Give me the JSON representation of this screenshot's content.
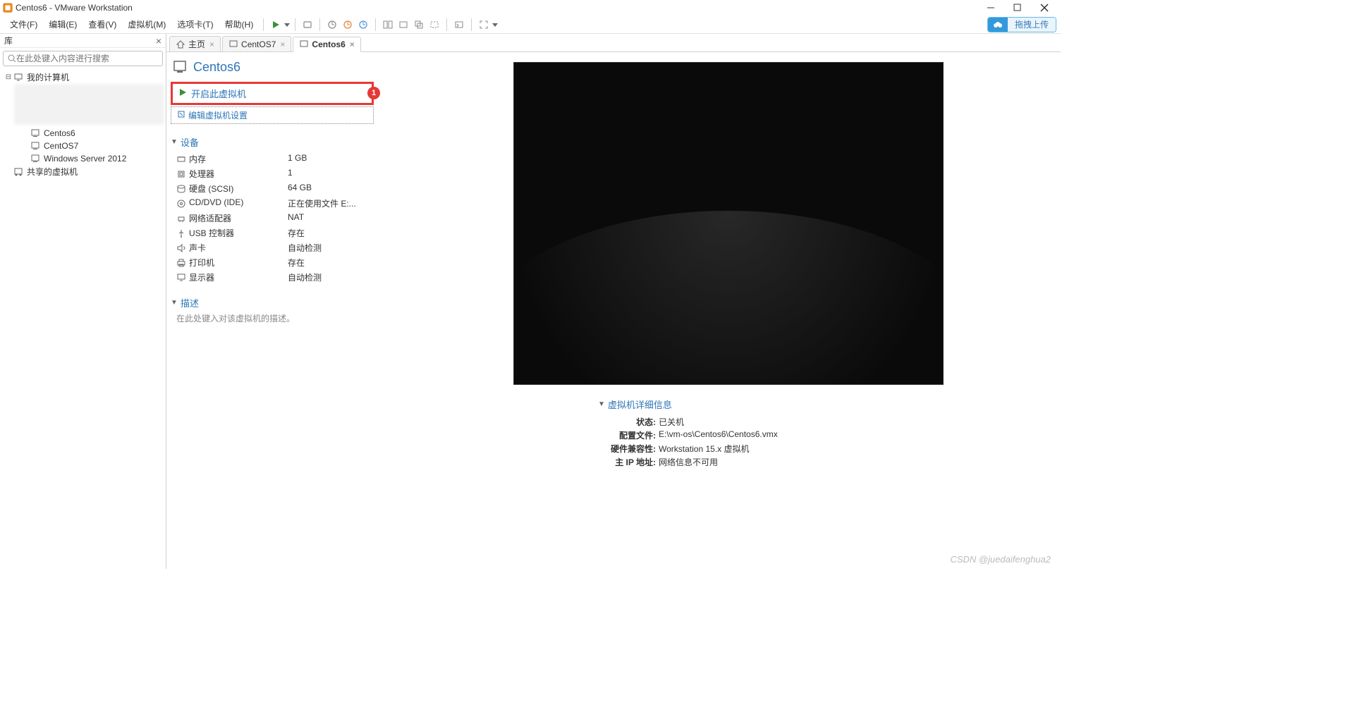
{
  "window": {
    "title": "Centos6 - VMware Workstation"
  },
  "menu": {
    "file": "文件(F)",
    "edit": "编辑(E)",
    "view": "查看(V)",
    "vm": "虚拟机(M)",
    "tabs": "选项卡(T)",
    "help": "帮助(H)"
  },
  "upload_badge": "拖拽上传",
  "sidebar": {
    "title": "库",
    "search_placeholder": "在此处键入内容进行搜索",
    "root": "我的计算机",
    "items": [
      "Centos6",
      "CentOS7",
      "Windows Server 2012"
    ],
    "shared": "共享的虚拟机"
  },
  "tabs": [
    {
      "label": "主页",
      "icon": "home",
      "active": false
    },
    {
      "label": "CentOS7",
      "icon": "vm",
      "active": false
    },
    {
      "label": "Centos6",
      "icon": "vm",
      "active": true
    }
  ],
  "vm": {
    "name": "Centos6",
    "power_on": "开启此虚拟机",
    "edit_settings": "编辑虚拟机设置",
    "badge": "1",
    "devices_header": "设备",
    "devices": [
      {
        "icon": "memory",
        "label": "内存",
        "value": "1 GB"
      },
      {
        "icon": "cpu",
        "label": "处理器",
        "value": "1"
      },
      {
        "icon": "disk",
        "label": "硬盘 (SCSI)",
        "value": "64 GB"
      },
      {
        "icon": "cd",
        "label": "CD/DVD (IDE)",
        "value": "正在使用文件 E:..."
      },
      {
        "icon": "network",
        "label": "网络适配器",
        "value": "NAT"
      },
      {
        "icon": "usb",
        "label": "USB 控制器",
        "value": "存在"
      },
      {
        "icon": "sound",
        "label": "声卡",
        "value": "自动检测"
      },
      {
        "icon": "printer",
        "label": "打印机",
        "value": "存在"
      },
      {
        "icon": "display",
        "label": "显示器",
        "value": "自动检测"
      }
    ],
    "desc_header": "描述",
    "desc_placeholder": "在此处键入对该虚拟机的描述。",
    "info_header": "虚拟机详细信息",
    "info": [
      {
        "label": "状态:",
        "value": "已关机"
      },
      {
        "label": "配置文件:",
        "value": "E:\\vm-os\\Centos6\\Centos6.vmx"
      },
      {
        "label": "硬件兼容性:",
        "value": "Workstation 15.x 虚拟机"
      },
      {
        "label": "主 IP 地址:",
        "value": "网络信息不可用"
      }
    ]
  },
  "watermark": "CSDN @juedaifenghua2"
}
